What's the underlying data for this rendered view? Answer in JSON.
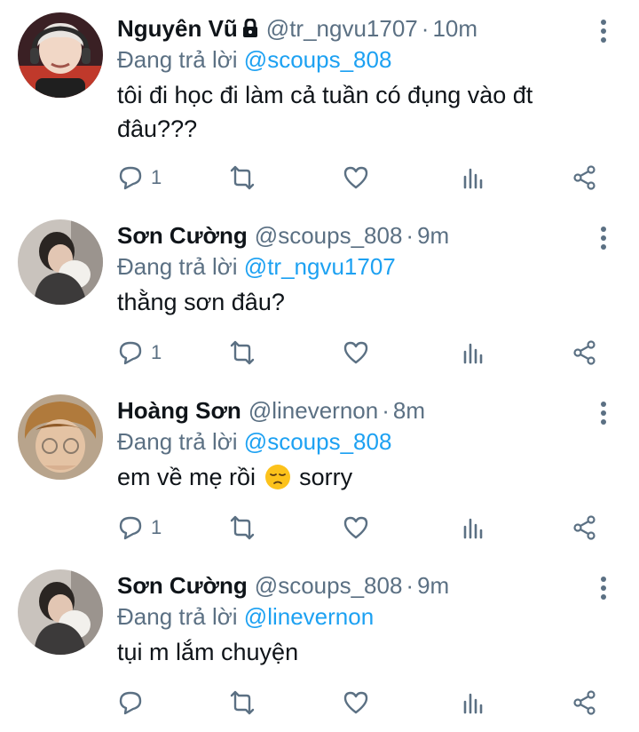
{
  "reply_prefix": "Đang trả lời",
  "colors": {
    "link": "#1da1f2",
    "muted": "#5b7083",
    "text": "#0f1419"
  },
  "tweets": [
    {
      "name": "Nguyên Vũ",
      "locked": true,
      "handle": "@tr_ngvu1707",
      "time": "10m",
      "reply_to": "@scoups_808",
      "text": "tôi đi học đi làm cả tuần có đụng vào đt đâu???",
      "reply_count": "1"
    },
    {
      "name": "Sơn Cường",
      "locked": false,
      "handle": "@scoups_808",
      "time": "9m",
      "reply_to": "@tr_ngvu1707",
      "text": "thằng sơn đâu?",
      "reply_count": "1"
    },
    {
      "name": "Hoàng Sơn",
      "locked": false,
      "handle": "@linevernon",
      "time": "8m",
      "reply_to": "@scoups_808",
      "text_before": "em về mẹ rồi",
      "emoji": "pensive-face-emoji",
      "text_after": "sorry",
      "reply_count": "1"
    },
    {
      "name": "Sơn Cường",
      "locked": false,
      "handle": "@scoups_808",
      "time": "9m",
      "reply_to": "@linevernon",
      "text": "tụi m lắm chuyện",
      "reply_count": ""
    }
  ]
}
